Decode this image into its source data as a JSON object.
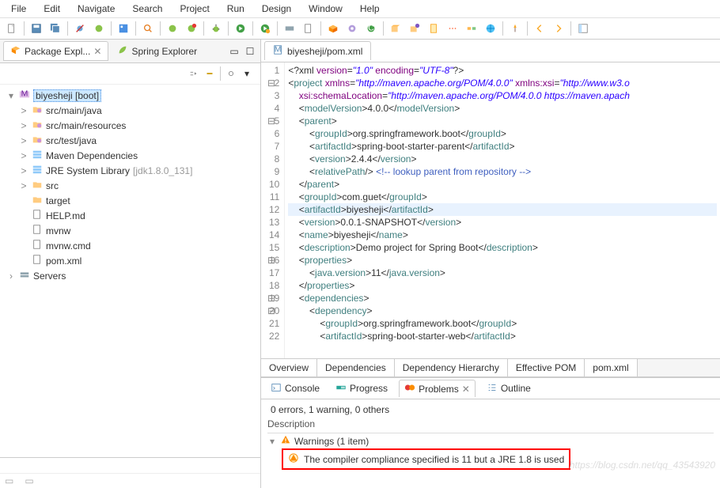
{
  "menubar": [
    "File",
    "Edit",
    "Navigate",
    "Search",
    "Project",
    "Run",
    "Design",
    "Window",
    "Help"
  ],
  "left": {
    "tabs": {
      "pkg": "Package Expl...",
      "spring": "Spring Explorer"
    },
    "project": "biyesheji [boot]",
    "items": [
      {
        "label": "src/main/java",
        "children_marker": ">"
      },
      {
        "label": "src/main/resources",
        "children_marker": ">"
      },
      {
        "label": "src/test/java",
        "children_marker": ">"
      },
      {
        "label": "Maven Dependencies",
        "children_marker": ">"
      },
      {
        "label": "JRE System Library",
        "ver": "[jdk1.8.0_131]",
        "children_marker": ">"
      },
      {
        "label": "src",
        "children_marker": ">"
      },
      {
        "label": "target"
      },
      {
        "label": "HELP.md"
      },
      {
        "label": "mvnw"
      },
      {
        "label": "mvnw.cmd"
      },
      {
        "label": "pom.xml"
      }
    ],
    "servers": "Servers"
  },
  "editor": {
    "tab": "biyesheji/pom.xml",
    "lines": [
      {
        "n": 1,
        "html": "&lt;?xml <span class='at'>version</span>=<span class='st'>\"1.0\"</span> <span class='at'>encoding</span>=<span class='st'>\"UTF-8\"</span>?&gt;"
      },
      {
        "n": 2,
        "html": "&lt;<span class='tg'>project</span> <span class='at'>xmlns</span>=<span class='st'>\"http://maven.apache.org/POM/4.0.0\"</span> <span class='at'>xmlns:xsi</span>=<span class='st'>\"http://www.w3.o</span>"
      },
      {
        "n": 3,
        "html": "    <span class='at'>xsi:schemaLocation</span>=<span class='st'>\"http://maven.apache.org/POM/4.0.0 https://maven.apach</span>"
      },
      {
        "n": 4,
        "html": "    &lt;<span class='tg'>modelVersion</span>&gt;4.0.0&lt;/<span class='tg'>modelVersion</span>&gt;"
      },
      {
        "n": 5,
        "html": "    &lt;<span class='tg'>parent</span>&gt;"
      },
      {
        "n": 6,
        "html": "        &lt;<span class='tg'>groupId</span>&gt;org.springframework.boot&lt;/<span class='tg'>groupId</span>&gt;"
      },
      {
        "n": 7,
        "html": "        &lt;<span class='tg'>artifactId</span>&gt;spring-boot-starter-parent&lt;/<span class='tg'>artifactId</span>&gt;"
      },
      {
        "n": 8,
        "html": "        &lt;<span class='tg'>version</span>&gt;2.4.4&lt;/<span class='tg'>version</span>&gt;"
      },
      {
        "n": 9,
        "html": "        &lt;<span class='tg'>relativePath</span>/&gt; <span class='cm'>&lt;!-- lookup parent from repository --&gt;</span>"
      },
      {
        "n": 10,
        "html": "    &lt;/<span class='tg'>parent</span>&gt;"
      },
      {
        "n": 11,
        "html": "    &lt;<span class='tg'>groupId</span>&gt;com.guet&lt;/<span class='tg'>groupId</span>&gt;"
      },
      {
        "n": 12,
        "html": "    &lt;<span class='tg'>artifactId</span>&gt;biyesheji&lt;/<span class='tg'>artifactId</span>&gt;",
        "hl": true
      },
      {
        "n": 13,
        "html": "    &lt;<span class='tg'>version</span>&gt;0.0.1-SNAPSHOT&lt;/<span class='tg'>version</span>&gt;"
      },
      {
        "n": 14,
        "html": "    &lt;<span class='tg'>name</span>&gt;biyesheji&lt;/<span class='tg'>name</span>&gt;"
      },
      {
        "n": 15,
        "html": "    &lt;<span class='tg'>description</span>&gt;Demo project for Spring Boot&lt;/<span class='tg'>description</span>&gt;"
      },
      {
        "n": 16,
        "html": "    &lt;<span class='tg'>properties</span>&gt;"
      },
      {
        "n": 17,
        "html": "        &lt;<span class='tg'>java.version</span>&gt;11&lt;/<span class='tg'>java.version</span>&gt;"
      },
      {
        "n": 18,
        "html": "    &lt;/<span class='tg'>properties</span>&gt;"
      },
      {
        "n": 19,
        "html": "    &lt;<span class='tg'>dependencies</span>&gt;"
      },
      {
        "n": 20,
        "html": "        &lt;<span class='tg'>dependency</span>&gt;"
      },
      {
        "n": 21,
        "html": "            &lt;<span class='tg'>groupId</span>&gt;org.springframework.boot&lt;/<span class='tg'>groupId</span>&gt;"
      },
      {
        "n": 22,
        "html": "            &lt;<span class='tg'>artifactId</span>&gt;spring-boot-starter-web&lt;/<span class='tg'>artifactId</span>&gt;"
      }
    ]
  },
  "bottom_tabs": [
    "Overview",
    "Dependencies",
    "Dependency Hierarchy",
    "Effective POM",
    "pom.xml"
  ],
  "panel_tabs": {
    "console": "Console",
    "progress": "Progress",
    "problems": "Problems",
    "outline": "Outline"
  },
  "problems": {
    "status": "0 errors, 1 warning, 0 others",
    "desc_header": "Description",
    "warnings_label": "Warnings (1 item)",
    "warning_msg": "The compiler compliance specified is 11 but a JRE 1.8 is used"
  },
  "watermark": "https://blog.csdn.net/qq_43543920"
}
